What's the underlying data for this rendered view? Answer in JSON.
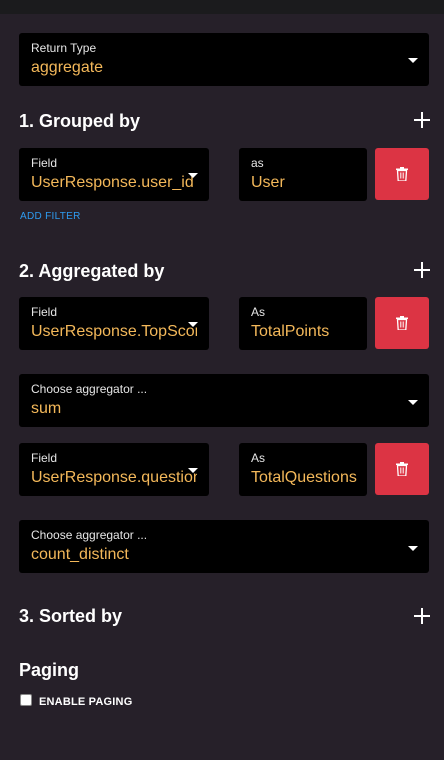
{
  "return_type": {
    "label": "Return Type",
    "value": "aggregate"
  },
  "grouped_by": {
    "heading": "1. Grouped by",
    "field_label": "Field",
    "field_value": "UserResponse.user_id",
    "as_label": "as",
    "as_value": "User",
    "add_filter": "ADD FILTER"
  },
  "aggregated_by": {
    "heading": "2. Aggregated by",
    "rows": [
      {
        "field_label": "Field",
        "field_value": "UserResponse.TopScore",
        "as_label": "As",
        "as_value": "TotalPoints",
        "aggregator_label": "Choose aggregator ...",
        "aggregator_value": "sum"
      },
      {
        "field_label": "Field",
        "field_value": "UserResponse.question_id",
        "as_label": "As",
        "as_value": "TotalQuestions",
        "aggregator_label": "Choose aggregator ...",
        "aggregator_value": "count_distinct"
      }
    ]
  },
  "sorted_by": {
    "heading": "3. Sorted by"
  },
  "paging": {
    "heading": "Paging",
    "enable_label": "ENABLE PAGING",
    "enabled": false
  },
  "colors": {
    "accent_value": "#f3b85a",
    "delete": "#dc3444",
    "link": "#2e9bf0",
    "background": "#262029"
  }
}
